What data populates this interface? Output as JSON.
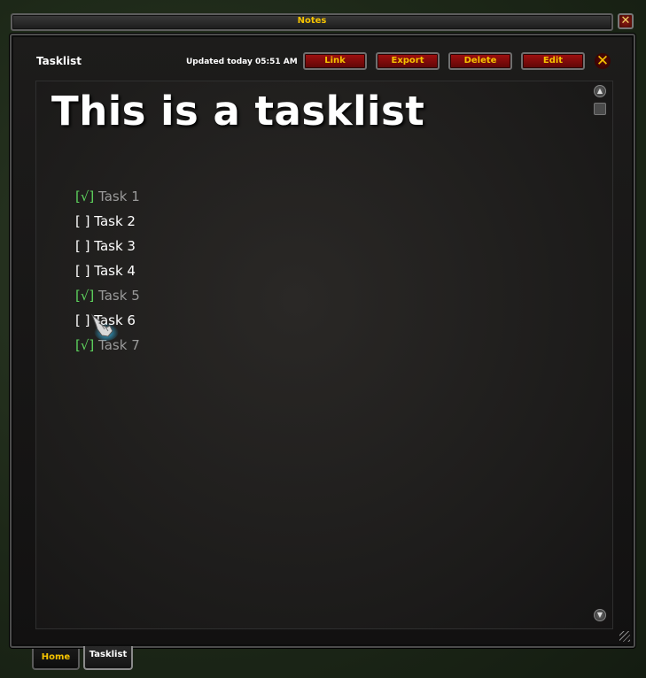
{
  "window": {
    "title": "Notes",
    "close_symbol": "✕"
  },
  "header": {
    "label": "Tasklist",
    "updated": "Updated today 05:51 AM",
    "buttons": {
      "link": "Link",
      "export": "Export",
      "delete": "Delete",
      "edit": "Edit"
    },
    "close_symbol": "✕"
  },
  "content": {
    "heading": "This is a tasklist",
    "tasks": [
      {
        "box": "[√]",
        "label": "Task 1",
        "done": true
      },
      {
        "box": "[ ]",
        "label": "Task 2",
        "done": false
      },
      {
        "box": "[ ]",
        "label": "Task 3",
        "done": false
      },
      {
        "box": "[ ]",
        "label": "Task 4",
        "done": false
      },
      {
        "box": "[√]",
        "label": "Task 5",
        "done": true
      },
      {
        "box": "[ ]",
        "label": "Task 6",
        "done": false
      },
      {
        "box": "[√]",
        "label": "Task 7",
        "done": true
      }
    ]
  },
  "tabs": {
    "home": "Home",
    "tasklist": "Tasklist",
    "active": "tasklist"
  },
  "colors": {
    "accent_gold": "#f5c300",
    "checked_green": "#5ed45e",
    "button_red": "#a01010"
  }
}
